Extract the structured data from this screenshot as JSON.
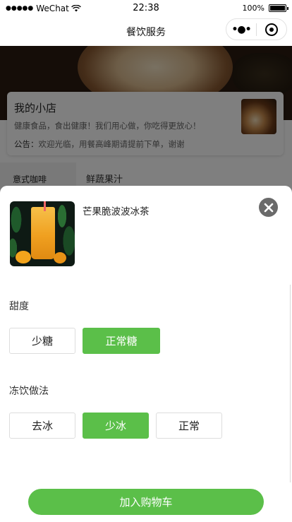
{
  "status_bar": {
    "signal": "●●●●●",
    "carrier": "WeChat",
    "time": "22:38",
    "battery_pct": "100%",
    "battery_level": 1.0
  },
  "nav": {
    "title": "餐饮服务",
    "more_icon": "more-icon",
    "close_icon": "mini-program-close-icon"
  },
  "shop": {
    "name": "我的小店",
    "description": "健康食品，食出健康！我们用心做，你吃得更放心！",
    "notice_label": "公告：",
    "notice_text": "欢迎光临，用餐高峰期请提前下单，谢谢"
  },
  "categories": {
    "active": "意式咖啡",
    "section_title": "鲜蔬果汁"
  },
  "modal": {
    "product_name": "芒果脆波波冰茶",
    "close_icon": "close-icon",
    "sections": [
      {
        "title": "甜度",
        "options": [
          {
            "label": "少糖",
            "selected": false
          },
          {
            "label": "正常糖",
            "selected": true
          }
        ]
      },
      {
        "title": "冻饮做法",
        "options": [
          {
            "label": "去冰",
            "selected": false
          },
          {
            "label": "少冰",
            "selected": true
          },
          {
            "label": "正常",
            "selected": false
          }
        ]
      }
    ]
  },
  "footer": {
    "add_to_cart": "加入购物车"
  },
  "colors": {
    "accent": "#5bbf49",
    "close_button": "#6a6a6a",
    "mask": "rgba(0,0,0,0.5)"
  }
}
